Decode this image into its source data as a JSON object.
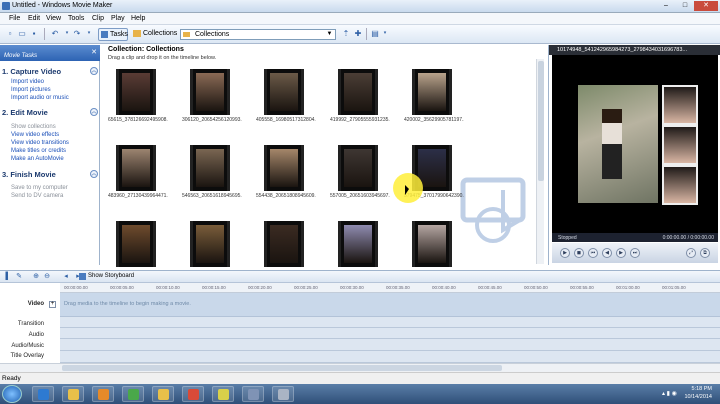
{
  "window": {
    "title": "Untitled - Windows Movie Maker",
    "controls": [
      "–",
      "□",
      "✕"
    ]
  },
  "menu": [
    "File",
    "Edit",
    "View",
    "Tools",
    "Clip",
    "Play",
    "Help"
  ],
  "toolbar": {
    "tasks_label": "Tasks",
    "collections_label": "Collections",
    "combo_value": "Collections"
  },
  "tasks_pane": {
    "header": "Movie Tasks",
    "sections": [
      {
        "title": "1. Capture Video",
        "links": [
          "Import video",
          "Import pictures",
          "Import audio or music"
        ],
        "enabled": true
      },
      {
        "title": "2. Edit Movie",
        "links": [
          "Show collections",
          "View video effects",
          "View video transitions",
          "Make titles or credits",
          "Make an AutoMovie"
        ],
        "enabled": true
      },
      {
        "title": "3. Finish Movie",
        "links": [
          "Save to my computer",
          "Send to DV camera"
        ],
        "enabled": false
      }
    ]
  },
  "collection": {
    "title": "Collection: Collections",
    "hint": "Drag a clip and drop it on the timeline below.",
    "clips": [
      {
        "caption": "65615_378126692495908...",
        "tone": "#5a3c35"
      },
      {
        "caption": "306120_20654256120993...",
        "tone": "#8a6a55"
      },
      {
        "caption": "405558_16980517312804...",
        "tone": "#6b5a48"
      },
      {
        "caption": "419992_27905555931235...",
        "tone": "#4b3e36"
      },
      {
        "caption": "420002_35629905781197...",
        "tone": "#b9a38c"
      },
      {
        "caption": "483960_27130439964471...",
        "tone": "#9c8470"
      },
      {
        "caption": "546563_20651618945695...",
        "tone": "#7a6652"
      },
      {
        "caption": "554438_20651808945609...",
        "tone": "#a5866a"
      },
      {
        "caption": "557005_20651603945697...",
        "tone": "#3e3632"
      },
      {
        "caption": "579475_37017990642390...",
        "tone": "#2c2f48"
      },
      {
        "caption": "",
        "tone": "#6e4b2d"
      },
      {
        "caption": "",
        "tone": "#7a5d3a"
      },
      {
        "caption": "",
        "tone": "#3b2b22"
      },
      {
        "caption": "",
        "tone": "#8f8bb0"
      },
      {
        "caption": "",
        "tone": "#b5a6a2"
      }
    ]
  },
  "monitor": {
    "title": "10174948_541242965984273_2798434031696783...",
    "status": "Stopped",
    "time": "0:00:00.00 / 0:00:00.00",
    "controls": [
      "▶",
      "◼",
      "⏮",
      "◀",
      "▶",
      "⏭",
      "⤢",
      "⧉"
    ]
  },
  "timeline": {
    "show_storyboard_label": "Show Storyboard",
    "tracks": [
      "Video",
      "Transition",
      "Audio",
      "Audio/Music",
      "Title Overlay"
    ],
    "hint": "Drag media to the timeline to begin making a movie.",
    "ruler_ticks": [
      "00:00:00.00",
      "00:00:05.00",
      "00:00:10.00",
      "00:00:15.00",
      "00:00:20.00",
      "00:00:25.00",
      "00:00:30.00",
      "00:00:35.00",
      "00:00:40.00",
      "00:00:45.00",
      "00:00:50.00",
      "00:00:55.00",
      "00:01:00.00",
      "00:01:05.00"
    ]
  },
  "status_bar": "Ready",
  "taskbar": {
    "apps": [
      {
        "name": "ie-icon",
        "color": "#2e7ad1"
      },
      {
        "name": "explorer-icon",
        "color": "#e8c04a"
      },
      {
        "name": "media-player-icon",
        "color": "#e58a2a"
      },
      {
        "name": "c-cleaner-icon",
        "color": "#4aa84a"
      },
      {
        "name": "folder-icon",
        "color": "#e8c04a"
      },
      {
        "name": "chrome-icon",
        "color": "#d94a38"
      },
      {
        "name": "notes-icon",
        "color": "#d8d04a"
      },
      {
        "name": "movie-maker-icon",
        "color": "#7f93b5"
      },
      {
        "name": "photos-icon",
        "color": "#aab4c4"
      }
    ],
    "time": "5:18 PM",
    "date": "10/14/2014"
  }
}
